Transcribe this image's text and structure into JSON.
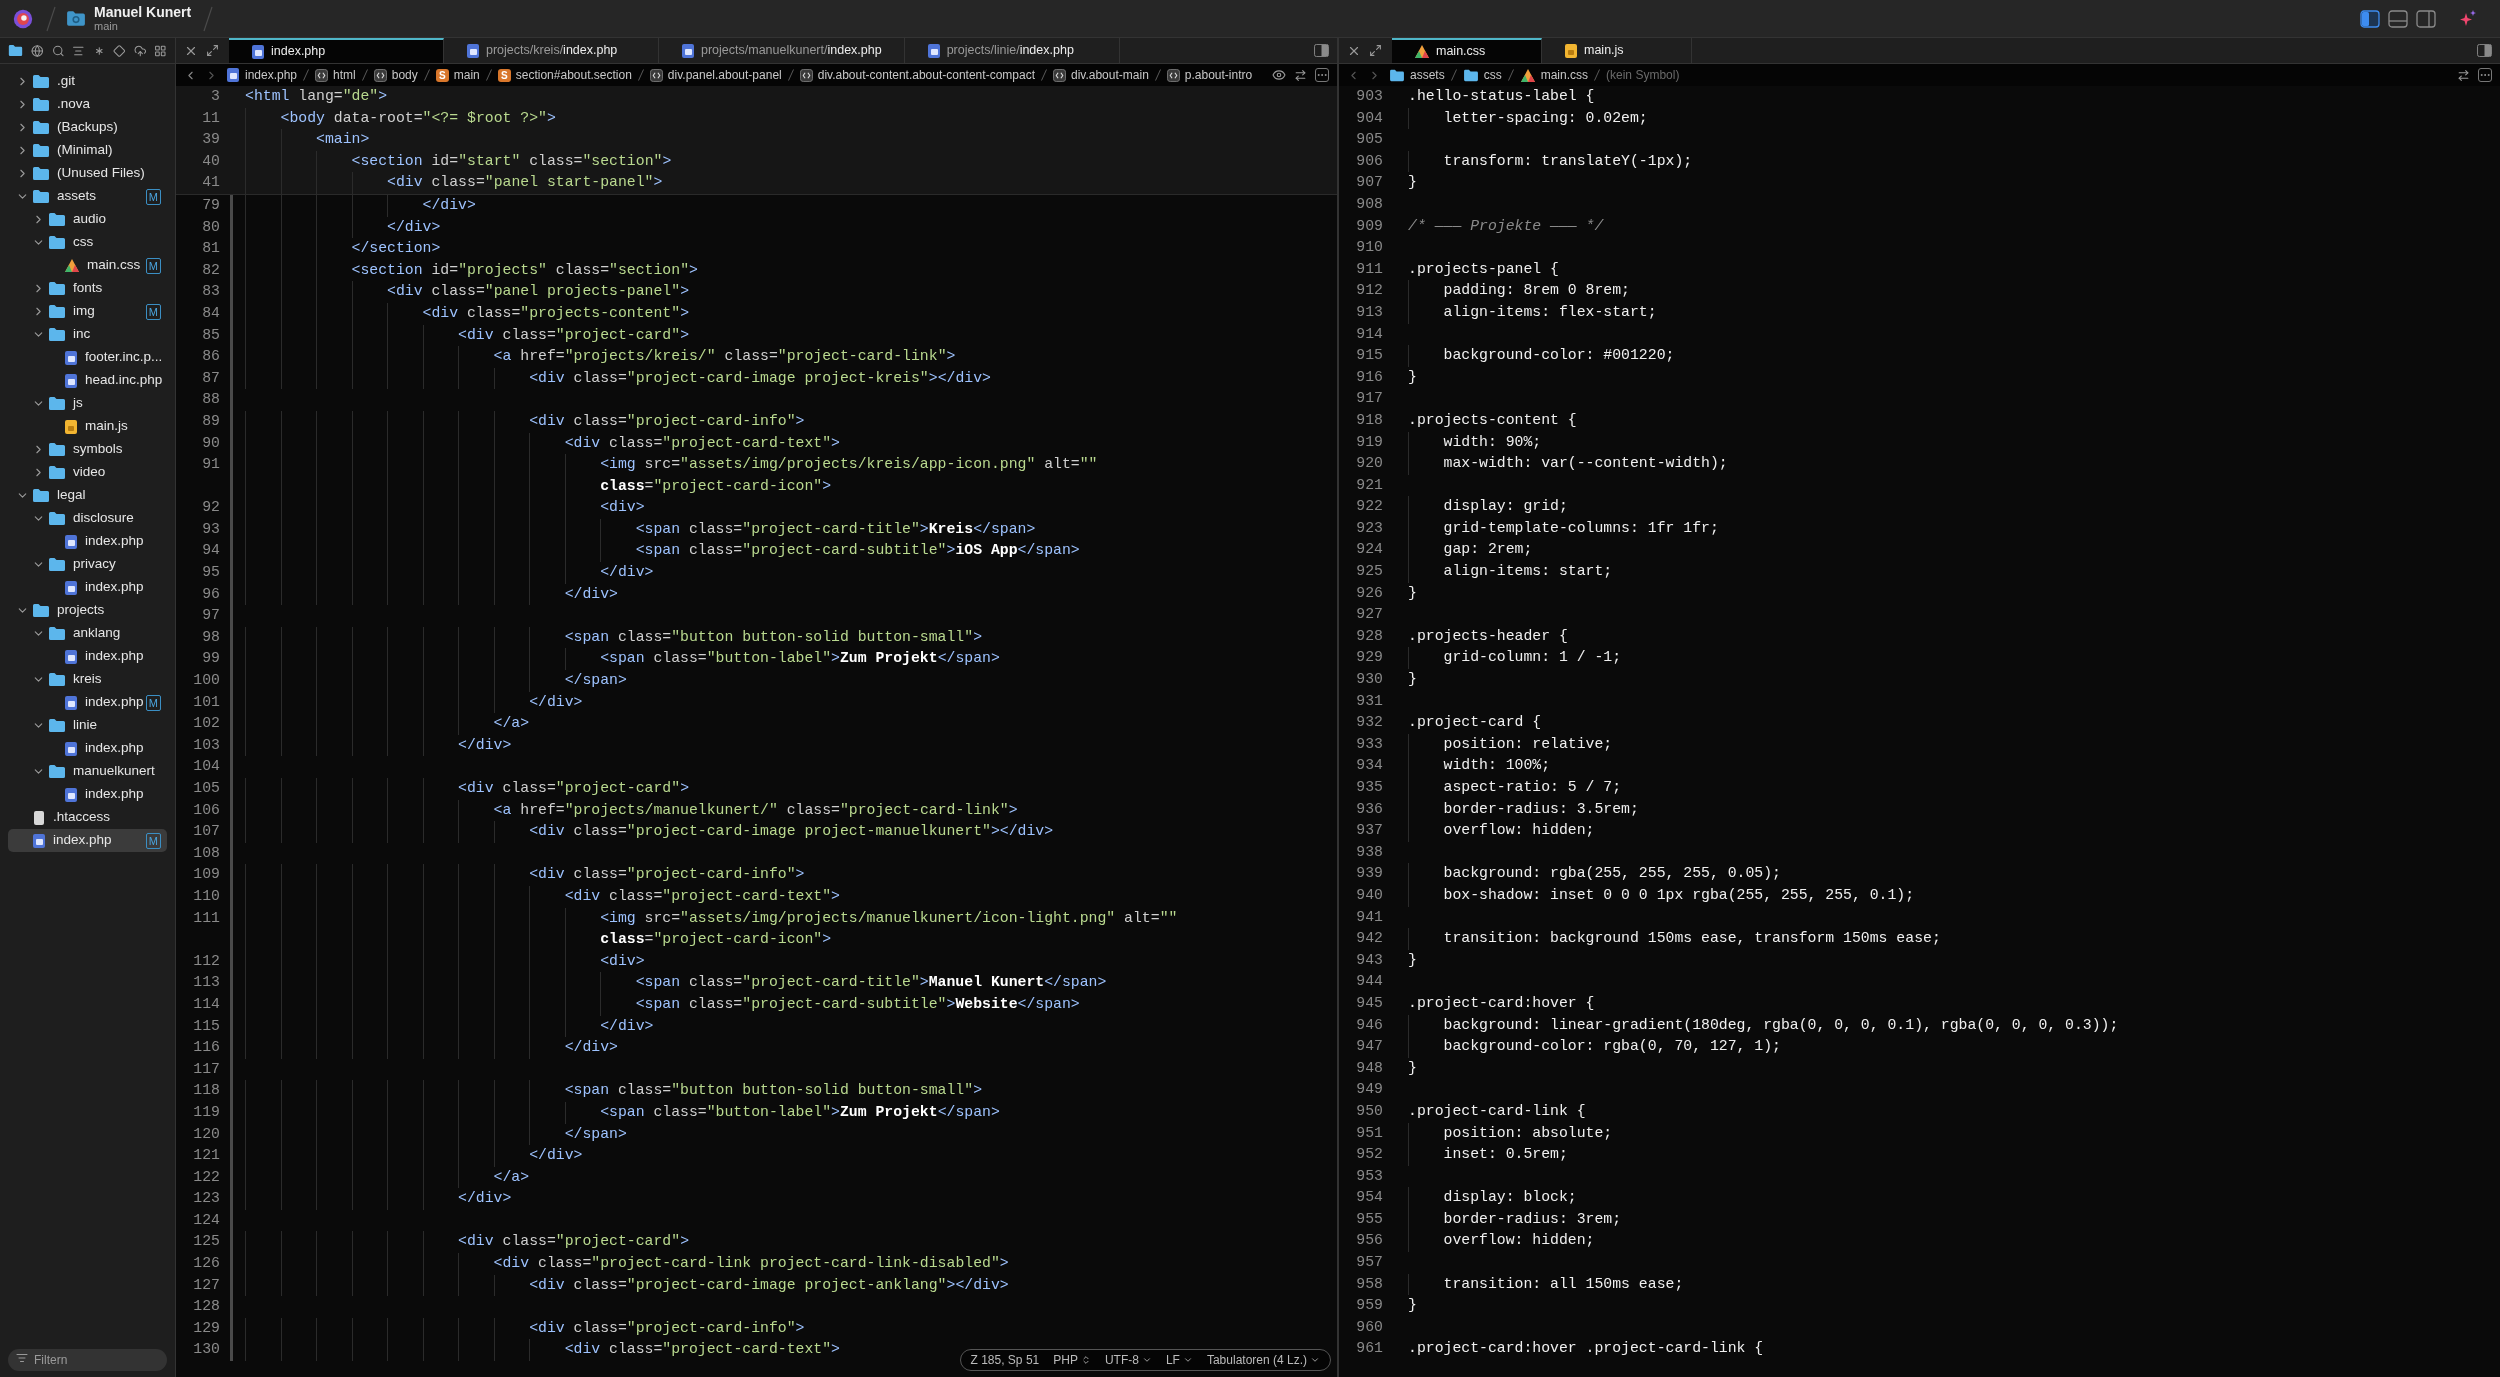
{
  "window": {
    "title": "Manuel Kunert",
    "branch": "main"
  },
  "layout_buttons": [
    {
      "selected": true
    },
    {
      "selected": false
    },
    {
      "selected": false
    }
  ],
  "sidebar": {
    "tree": [
      {
        "label": ".git",
        "kind": "folder",
        "expanded": false,
        "selected": false
      },
      {
        "label": ".nova",
        "kind": "folder",
        "expanded": false,
        "selected": false
      },
      {
        "label": "(Backups)",
        "kind": "folder",
        "expanded": false,
        "selected": false
      },
      {
        "label": "(Minimal)",
        "kind": "folder",
        "expanded": false,
        "selected": false
      },
      {
        "label": "(Unused Files)",
        "kind": "folder",
        "expanded": false,
        "selected": false
      },
      {
        "label": "assets",
        "kind": "folder",
        "expanded": true,
        "selected": false,
        "status": "M",
        "children": [
          {
            "label": "audio",
            "kind": "folder",
            "expanded": false,
            "selected": false
          },
          {
            "label": "css",
            "kind": "folder",
            "expanded": true,
            "selected": false,
            "children": [
              {
                "label": "main.css",
                "kind": "css",
                "selected": false,
                "status": "M"
              }
            ]
          },
          {
            "label": "fonts",
            "kind": "folder",
            "expanded": false,
            "selected": false
          },
          {
            "label": "img",
            "kind": "folder",
            "expanded": false,
            "selected": false,
            "status": "M"
          },
          {
            "label": "inc",
            "kind": "folder",
            "expanded": true,
            "selected": false,
            "children": [
              {
                "label": "footer.inc.p...",
                "kind": "php",
                "selected": false
              },
              {
                "label": "head.inc.php",
                "kind": "php",
                "selected": false
              }
            ]
          },
          {
            "label": "js",
            "kind": "folder",
            "expanded": true,
            "selected": false,
            "children": [
              {
                "label": "main.js",
                "kind": "js",
                "selected": false
              }
            ]
          },
          {
            "label": "symbols",
            "kind": "folder",
            "expanded": false,
            "selected": false
          },
          {
            "label": "video",
            "kind": "folder",
            "expanded": false,
            "selected": false
          }
        ]
      },
      {
        "label": "legal",
        "kind": "folder",
        "expanded": true,
        "selected": false,
        "children": [
          {
            "label": "disclosure",
            "kind": "folder",
            "expanded": true,
            "selected": false,
            "children": [
              {
                "label": "index.php",
                "kind": "php",
                "selected": false
              }
            ]
          },
          {
            "label": "privacy",
            "kind": "folder",
            "expanded": true,
            "selected": false,
            "children": [
              {
                "label": "index.php",
                "kind": "php",
                "selected": false
              }
            ]
          }
        ]
      },
      {
        "label": "projects",
        "kind": "folder",
        "expanded": true,
        "selected": false,
        "children": [
          {
            "label": "anklang",
            "kind": "folder",
            "expanded": true,
            "selected": false,
            "children": [
              {
                "label": "index.php",
                "kind": "php",
                "selected": false
              }
            ]
          },
          {
            "label": "kreis",
            "kind": "folder",
            "expanded": true,
            "selected": false,
            "children": [
              {
                "label": "index.php",
                "kind": "php",
                "selected": false,
                "status": "M"
              }
            ]
          },
          {
            "label": "linie",
            "kind": "folder",
            "expanded": true,
            "selected": false,
            "children": [
              {
                "label": "index.php",
                "kind": "php",
                "selected": false
              }
            ]
          },
          {
            "label": "manuelkunert",
            "kind": "folder",
            "expanded": true,
            "selected": false,
            "children": [
              {
                "label": "index.php",
                "kind": "php",
                "selected": false
              }
            ]
          }
        ]
      },
      {
        "label": ".htaccess",
        "kind": "plain",
        "selected": false
      },
      {
        "label": "index.php",
        "kind": "php",
        "selected": true,
        "status": "M"
      }
    ],
    "filter": {
      "placeholder": "Filtern"
    }
  },
  "left_editor": {
    "kind": "html",
    "tabs": [
      {
        "name": "index.php",
        "selected": true
      },
      {
        "dir": "projects/kreis/",
        "name": "index.php",
        "selected": false
      },
      {
        "dir": "projects/manuelkunert/",
        "name": "index.php",
        "selected": false
      },
      {
        "dir": "projects/linie/",
        "name": "index.php",
        "selected": false
      }
    ],
    "breadcrumbs": [
      {
        "label": "index.php",
        "kind": "php"
      },
      {
        "label": "html",
        "kind": "element"
      },
      {
        "label": "body",
        "kind": "element"
      },
      {
        "label": "main",
        "kind": "section",
        "badge": "S"
      },
      {
        "label": "section#about.section",
        "kind": "section",
        "badge": "S"
      },
      {
        "label": "div.panel.about-panel",
        "kind": "element"
      },
      {
        "label": "div.about-content.about-content-compact",
        "kind": "element"
      },
      {
        "label": "div.about-main",
        "kind": "element"
      },
      {
        "label": "p.about-intro",
        "kind": "element"
      }
    ],
    "sticky_lines": [
      {
        "n": "3",
        "text": "<html lang=\"de\">"
      },
      {
        "n": "11",
        "text": "    <body data-root=\"<?= $root ?>\">"
      },
      {
        "n": "39",
        "text": "        <main>"
      },
      {
        "n": "40",
        "text": "            <section id=\"start\" class=\"section\">"
      },
      {
        "n": "41",
        "text": "                <div class=\"panel start-panel\">"
      }
    ],
    "lines": [
      {
        "n": "79",
        "text": "                    </div>"
      },
      {
        "n": "80",
        "text": "                </div>"
      },
      {
        "n": "81",
        "text": "            </section>"
      },
      {
        "n": "82",
        "text": "            <section id=\"projects\" class=\"section\">"
      },
      {
        "n": "83",
        "text": "                <div class=\"panel projects-panel\">"
      },
      {
        "n": "84",
        "text": "                    <div class=\"projects-content\">"
      },
      {
        "n": "85",
        "text": "                        <div class=\"project-card\">"
      },
      {
        "n": "86",
        "text": "                            <a href=\"projects/kreis/\" class=\"project-card-link\">"
      },
      {
        "n": "87",
        "text": "                                <div class=\"project-card-image project-kreis\"></div>"
      },
      {
        "n": "88"
      },
      {
        "n": "89",
        "text": "                                <div class=\"project-card-info\">"
      },
      {
        "n": "90",
        "text": "                                    <div class=\"project-card-text\">"
      },
      {
        "n": "91",
        "text": "                                        <img src=\"assets/img/projects/kreis/app-icon.png\" alt=\"\"",
        "wrap": "                                        class=\"project-card-icon\">"
      },
      {
        "n": "92",
        "text": "                                        <div>"
      },
      {
        "n": "93",
        "text": "                                            <span class=\"project-card-title\">Kreis</span>"
      },
      {
        "n": "94",
        "text": "                                            <span class=\"project-card-subtitle\">iOS App</span>"
      },
      {
        "n": "95",
        "text": "                                        </div>"
      },
      {
        "n": "96",
        "text": "                                    </div>"
      },
      {
        "n": "97"
      },
      {
        "n": "98",
        "text": "                                    <span class=\"button button-solid button-small\">"
      },
      {
        "n": "99",
        "text": "                                        <span class=\"button-label\">Zum Projekt</span>"
      },
      {
        "n": "100",
        "text": "                                    </span>"
      },
      {
        "n": "101",
        "text": "                                </div>"
      },
      {
        "n": "102",
        "text": "                            </a>"
      },
      {
        "n": "103",
        "text": "                        </div>"
      },
      {
        "n": "104"
      },
      {
        "n": "105",
        "text": "                        <div class=\"project-card\">"
      },
      {
        "n": "106",
        "text": "                            <a href=\"projects/manuelkunert/\" class=\"project-card-link\">"
      },
      {
        "n": "107",
        "text": "                                <div class=\"project-card-image project-manuelkunert\"></div>"
      },
      {
        "n": "108"
      },
      {
        "n": "109",
        "text": "                                <div class=\"project-card-info\">"
      },
      {
        "n": "110",
        "text": "                                    <div class=\"project-card-text\">"
      },
      {
        "n": "111",
        "text": "                                        <img src=\"assets/img/projects/manuelkunert/icon-light.png\" alt=\"\"",
        "wrap": "                                        class=\"project-card-icon\">"
      },
      {
        "n": "112",
        "text": "                                        <div>"
      },
      {
        "n": "113",
        "text": "                                            <span class=\"project-card-title\">Manuel Kunert</span>"
      },
      {
        "n": "114",
        "text": "                                            <span class=\"project-card-subtitle\">Website</span>"
      },
      {
        "n": "115",
        "text": "                                        </div>"
      },
      {
        "n": "116",
        "text": "                                    </div>"
      },
      {
        "n": "117"
      },
      {
        "n": "118",
        "text": "                                    <span class=\"button button-solid button-small\">"
      },
      {
        "n": "119",
        "text": "                                        <span class=\"button-label\">Zum Projekt</span>"
      },
      {
        "n": "120",
        "text": "                                    </span>"
      },
      {
        "n": "121",
        "text": "                                </div>"
      },
      {
        "n": "122",
        "text": "                            </a>"
      },
      {
        "n": "123",
        "text": "                        </div>"
      },
      {
        "n": "124"
      },
      {
        "n": "125",
        "text": "                        <div class=\"project-card\">"
      },
      {
        "n": "126",
        "text": "                            <div class=\"project-card-link project-card-link-disabled\">"
      },
      {
        "n": "127",
        "text": "                                <div class=\"project-card-image project-anklang\"></div>"
      },
      {
        "n": "128"
      },
      {
        "n": "129",
        "text": "                                <div class=\"project-card-info\">"
      },
      {
        "n": "130",
        "text": "                                    <div class=\"project-card-text\">"
      }
    ],
    "status_bar": [
      {
        "text": "Z 185, Sp 51",
        "kind": "text"
      },
      {
        "text": "PHP",
        "kind": "stepper"
      },
      {
        "text": "UTF-8",
        "kind": "menu"
      },
      {
        "text": "LF",
        "kind": "menu"
      },
      {
        "text": "Tabulatoren (4 Lz.)",
        "kind": "menu"
      }
    ]
  },
  "right_editor": {
    "kind": "css",
    "tabs": [
      {
        "name": "main.css",
        "kind": "css",
        "selected": true
      },
      {
        "name": "main.js",
        "kind": "js",
        "selected": false
      }
    ],
    "breadcrumbs": [
      {
        "label": "assets",
        "kind": "folder"
      },
      {
        "label": "css",
        "kind": "folder"
      },
      {
        "label": "main.css",
        "kind": "css"
      },
      {
        "label": "(kein Symbol)",
        "kind": "none"
      }
    ],
    "lines": [
      {
        "n": "903",
        "text": ".hello-status-label {"
      },
      {
        "n": "904",
        "text": "    letter-spacing: 0.02em;"
      },
      {
        "n": "905"
      },
      {
        "n": "906",
        "text": "    transform: translateY(-1px);"
      },
      {
        "n": "907",
        "text": "}"
      },
      {
        "n": "908"
      },
      {
        "n": "909",
        "text": "/* ——— Projekte ——— */"
      },
      {
        "n": "910"
      },
      {
        "n": "911",
        "text": ".projects-panel {"
      },
      {
        "n": "912",
        "text": "    padding: 8rem 0 8rem;"
      },
      {
        "n": "913",
        "text": "    align-items: flex-start;"
      },
      {
        "n": "914"
      },
      {
        "n": "915",
        "text": "    background-color: #001220;"
      },
      {
        "n": "916",
        "text": "}"
      },
      {
        "n": "917"
      },
      {
        "n": "918",
        "text": ".projects-content {"
      },
      {
        "n": "919",
        "text": "    width: 90%;"
      },
      {
        "n": "920",
        "text": "    max-width: var(--content-width);"
      },
      {
        "n": "921"
      },
      {
        "n": "922",
        "text": "    display: grid;"
      },
      {
        "n": "923",
        "text": "    grid-template-columns: 1fr 1fr;"
      },
      {
        "n": "924",
        "text": "    gap: 2rem;"
      },
      {
        "n": "925",
        "text": "    align-items: start;"
      },
      {
        "n": "926",
        "text": "}"
      },
      {
        "n": "927"
      },
      {
        "n": "928",
        "text": ".projects-header {"
      },
      {
        "n": "929",
        "text": "    grid-column: 1 / -1;"
      },
      {
        "n": "930",
        "text": "}"
      },
      {
        "n": "931"
      },
      {
        "n": "932",
        "text": ".project-card {"
      },
      {
        "n": "933",
        "text": "    position: relative;"
      },
      {
        "n": "934",
        "text": "    width: 100%;"
      },
      {
        "n": "935",
        "text": "    aspect-ratio: 5 / 7;"
      },
      {
        "n": "936",
        "text": "    border-radius: 3.5rem;"
      },
      {
        "n": "937",
        "text": "    overflow: hidden;"
      },
      {
        "n": "938"
      },
      {
        "n": "939",
        "text": "    background: rgba(255, 255, 255, 0.05);"
      },
      {
        "n": "940",
        "text": "    box-shadow: inset 0 0 0 1px rgba(255, 255, 255, 0.1);"
      },
      {
        "n": "941"
      },
      {
        "n": "942",
        "text": "    transition: background 150ms ease, transform 150ms ease;"
      },
      {
        "n": "943",
        "text": "}"
      },
      {
        "n": "944"
      },
      {
        "n": "945",
        "text": ".project-card:hover {"
      },
      {
        "n": "946",
        "text": "    background: linear-gradient(180deg, rgba(0, 0, 0, 0.1), rgba(0, 0, 0, 0.3));"
      },
      {
        "n": "947",
        "text": "    background-color: rgba(0, 70, 127, 1);"
      },
      {
        "n": "948",
        "text": "}"
      },
      {
        "n": "949"
      },
      {
        "n": "950",
        "text": ".project-card-link {"
      },
      {
        "n": "951",
        "text": "    position: absolute;"
      },
      {
        "n": "952",
        "text": "    inset: 0.5rem;"
      },
      {
        "n": "953"
      },
      {
        "n": "954",
        "text": "    display: block;"
      },
      {
        "n": "955",
        "text": "    border-radius: 3rem;"
      },
      {
        "n": "956",
        "text": "    overflow: hidden;"
      },
      {
        "n": "957"
      },
      {
        "n": "958",
        "text": "    transition: all 150ms ease;"
      },
      {
        "n": "959",
        "text": "}"
      },
      {
        "n": "960"
      },
      {
        "n": "961",
        "text": ".project-card:hover .project-card-link {"
      }
    ]
  }
}
